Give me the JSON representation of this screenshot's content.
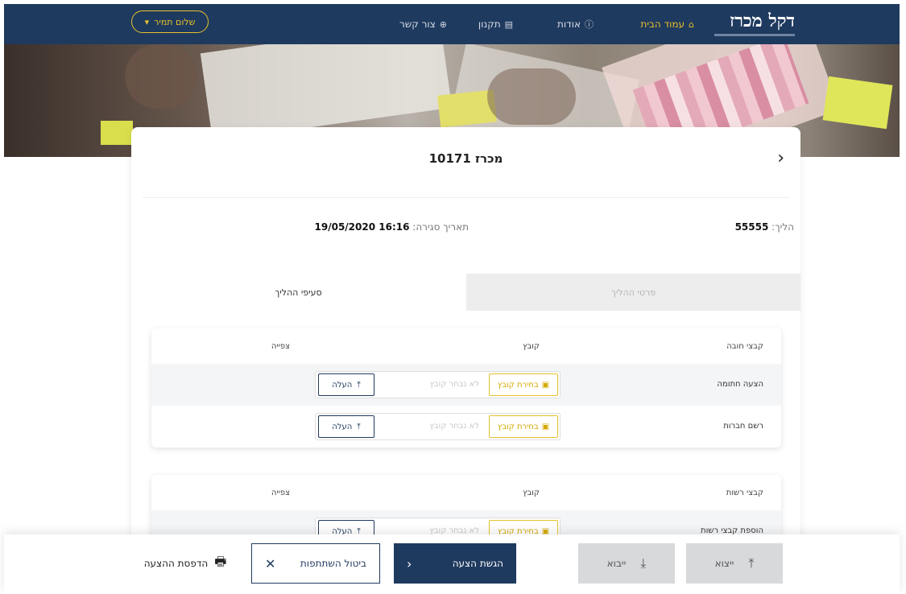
{
  "header": {
    "logo": "דקל מכרז",
    "nav": [
      {
        "label": "עמוד הבית",
        "icon": "home-icon",
        "glyph": "⌂",
        "active": true
      },
      {
        "label": "אודות",
        "icon": "info-icon",
        "glyph": "ⓘ",
        "active": false
      },
      {
        "label": "תקנון",
        "icon": "document-icon",
        "glyph": "▤",
        "active": false
      },
      {
        "label": "צור קשר",
        "icon": "contact-icon",
        "glyph": "⊕",
        "active": false
      }
    ],
    "user_greeting": "שלום תמיר"
  },
  "page": {
    "title": "מכרז 10171",
    "process_label": "הליך:",
    "process_value": "55555",
    "closing_label": "תאריך סגירה:",
    "closing_value": "16:16 19/05/2020"
  },
  "tabs": [
    {
      "label": "פרטי ההליך",
      "active": false
    },
    {
      "label": "סעיפי ההליך",
      "active": true
    }
  ],
  "sections": [
    {
      "headers": {
        "name": "קבצי חובה",
        "file": "קובץ",
        "view": "צפייה"
      },
      "rows": [
        {
          "label": "הצעה חתומה",
          "choose": "בחירת קובץ",
          "placeholder": "לא נבחר קובץ",
          "upload": "העלה"
        },
        {
          "label": "רשם חברות",
          "choose": "בחירת קובץ",
          "placeholder": "לא נבחר קובץ",
          "upload": "העלה"
        }
      ]
    },
    {
      "headers": {
        "name": "קבצי רשות",
        "file": "קובץ",
        "view": "צפייה"
      },
      "rows": [
        {
          "label": "הוספת קבצי רשות",
          "choose": "בחירת קובץ",
          "placeholder": "לא נבחר קובץ",
          "upload": "העלה"
        }
      ]
    }
  ],
  "footer": {
    "export": "ייצוא",
    "import": "ייבוא",
    "submit": "הגשת הצעה",
    "cancel": "ביטול השתתפות",
    "print": "הדפסת ההצעה"
  },
  "colors": {
    "primary": "#1f3a5f",
    "accent": "#e6c02a"
  }
}
